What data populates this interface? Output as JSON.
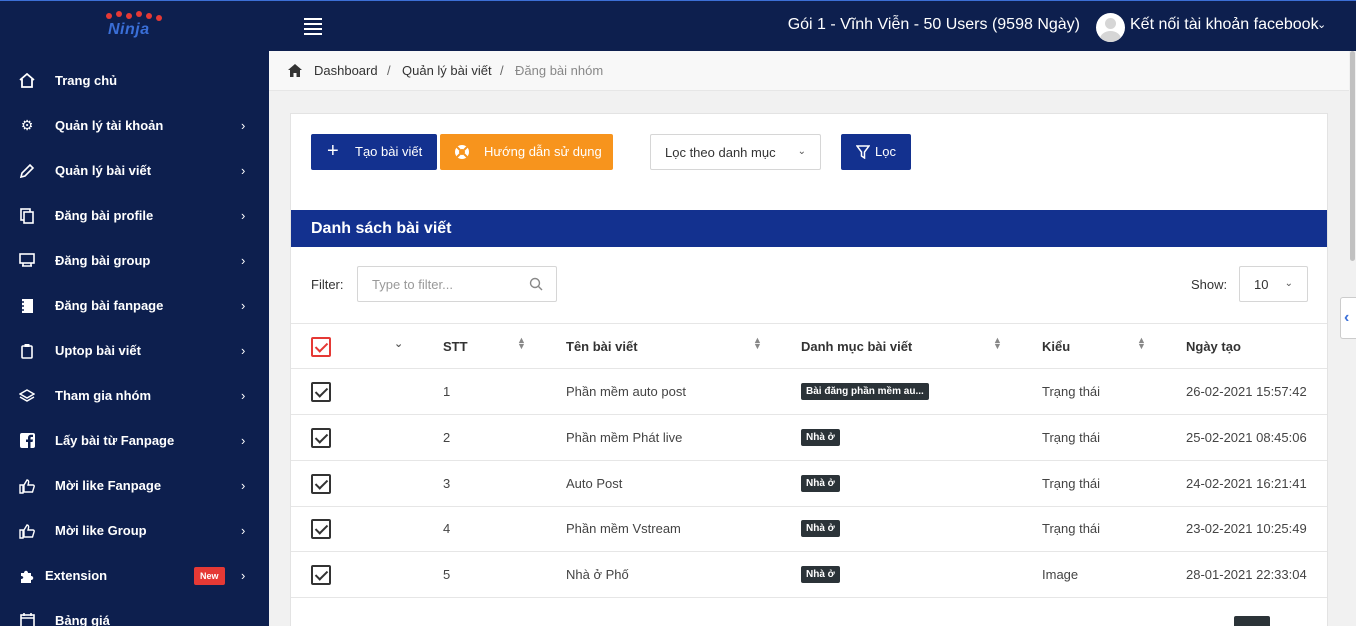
{
  "header": {
    "logo_text": "Ninja",
    "plan_text": "Gói 1 - Vĩnh Viễn - 50 Users (9598 Ngày)",
    "account_text": "Kết nối tài khoản facebook"
  },
  "sidebar": {
    "items": [
      {
        "label": "Trang chủ",
        "icon": "home-icon"
      },
      {
        "label": "Quản lý tài khoản",
        "icon": "gear-icon"
      },
      {
        "label": "Quản lý bài viết",
        "icon": "pencil-icon"
      },
      {
        "label": "Đăng bài profile",
        "icon": "copy-icon"
      },
      {
        "label": "Đăng bài group",
        "icon": "group-icon"
      },
      {
        "label": "Đăng bài fanpage",
        "icon": "notebook-icon"
      },
      {
        "label": "Uptop bài viết",
        "icon": "clipboard-icon"
      },
      {
        "label": "Tham gia nhóm",
        "icon": "layers-icon"
      },
      {
        "label": "Lấy bài từ Fanpage",
        "icon": "facebook-icon"
      },
      {
        "label": "Mời like Fanpage",
        "icon": "thumbs-up-icon"
      },
      {
        "label": "Mời like Group",
        "icon": "thumbs-up-icon"
      },
      {
        "label": "Extension",
        "icon": "puzzle-icon",
        "badge": "New"
      },
      {
        "label": "Bảng giá",
        "icon": "calendar-icon"
      }
    ]
  },
  "breadcrumb": {
    "items": [
      "Dashboard",
      "Quản lý bài viết",
      "Đăng bài nhóm"
    ],
    "separator": "/"
  },
  "toolbar": {
    "create_label": "Tạo bài viết",
    "guide_label": "Hướng dẫn sử dụng",
    "category_select": "Lọc theo danh mục",
    "filter_label": "Lọc"
  },
  "list": {
    "title": "Danh sách bài viết",
    "filter_label": "Filter:",
    "filter_placeholder": "Type to filter...",
    "show_label": "Show:",
    "show_value": "10",
    "columns": [
      "STT",
      "Tên bài viết",
      "Danh mục bài viết",
      "Kiểu",
      "Ngày tạo"
    ],
    "rows": [
      {
        "stt": "1",
        "name": "Phần mềm auto post",
        "category": "Bài đăng phần mềm au...",
        "type": "Trạng thái",
        "date": "26-02-2021 15:57:42"
      },
      {
        "stt": "2",
        "name": "Phần mềm Phát live",
        "category": "Nhà ở",
        "type": "Trạng thái",
        "date": "25-02-2021 08:45:06"
      },
      {
        "stt": "3",
        "name": "Auto Post",
        "category": "Nhà ở",
        "type": "Trạng thái",
        "date": "24-02-2021 16:21:41"
      },
      {
        "stt": "4",
        "name": "Phần mềm Vstream",
        "category": "Nhà ở",
        "type": "Trạng thái",
        "date": "23-02-2021 10:25:49"
      },
      {
        "stt": "5",
        "name": "Nhà ở Phố",
        "category": "Nhà ở",
        "type": "Image",
        "date": "28-01-2021 22:33:04"
      }
    ]
  },
  "colors": {
    "navy": "#0d1f4e",
    "primary": "#13318f",
    "orange": "#f7941d",
    "badge_dark": "#2b3338",
    "new_badge": "#e53935"
  }
}
